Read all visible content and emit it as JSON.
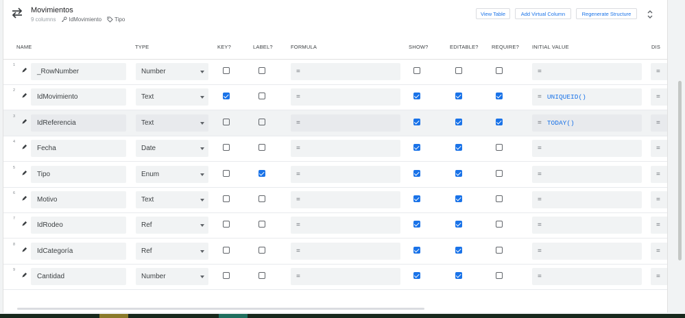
{
  "table": {
    "name": "Movimientos",
    "columns_count": "9 columns",
    "key_column": "IdMovimiento",
    "label_column": "Tipo",
    "swap_icon": "swap-horizontal-icon",
    "key_icon": "key-icon",
    "label_icon": "tag-icon"
  },
  "actions": {
    "view_table": "View Table",
    "add_virtual_column": "Add Virtual Column",
    "regenerate_structure": "Regenerate Structure",
    "expand_icon": "unfold-icon"
  },
  "headers": {
    "name": "NAME",
    "type": "TYPE",
    "key": "KEY?",
    "label": "LABEL?",
    "formula": "FORMULA",
    "show": "SHOW?",
    "editable": "EDITABLE?",
    "require": "REQUIRE?",
    "initial_value": "INITIAL VALUE",
    "display": "DIS"
  },
  "formula_prefix": "=",
  "colors": {
    "accent": "#1a73e8",
    "checkbox_on": "#1a73e8",
    "row_highlight": "#f1f3f4",
    "taskbar": "#17281c"
  },
  "columns": [
    {
      "index": "1",
      "name": "_RowNumber",
      "type": "Number",
      "key": false,
      "label": false,
      "formula": "=",
      "show": false,
      "editable": false,
      "require": false,
      "initial_value": "=",
      "initial_code": "",
      "display": "="
    },
    {
      "index": "2",
      "name": "IdMovimiento",
      "type": "Text",
      "key": true,
      "label": false,
      "formula": "=",
      "show": true,
      "editable": true,
      "require": true,
      "initial_value": "=",
      "initial_code": "UNIQUEID()",
      "display": "="
    },
    {
      "index": "3",
      "name": "IdReferencia",
      "type": "Text",
      "key": false,
      "label": false,
      "formula": "=",
      "show": true,
      "editable": true,
      "require": true,
      "initial_value": "=",
      "initial_code": "TODAY()",
      "display": "="
    },
    {
      "index": "4",
      "name": "Fecha",
      "type": "Date",
      "key": false,
      "label": false,
      "formula": "=",
      "show": true,
      "editable": true,
      "require": false,
      "initial_value": "=",
      "initial_code": "",
      "display": "="
    },
    {
      "index": "5",
      "name": "Tipo",
      "type": "Enum",
      "key": false,
      "label": true,
      "formula": "=",
      "show": true,
      "editable": true,
      "require": false,
      "initial_value": "=",
      "initial_code": "",
      "display": "="
    },
    {
      "index": "6",
      "name": "Motivo",
      "type": "Text",
      "key": false,
      "label": false,
      "formula": "=",
      "show": true,
      "editable": true,
      "require": false,
      "initial_value": "=",
      "initial_code": "",
      "display": "="
    },
    {
      "index": "7",
      "name": "IdRodeo",
      "type": "Ref",
      "key": false,
      "label": false,
      "formula": "=",
      "show": true,
      "editable": true,
      "require": false,
      "initial_value": "=",
      "initial_code": "",
      "display": "="
    },
    {
      "index": "8",
      "name": "IdCategoría",
      "type": "Ref",
      "key": false,
      "label": false,
      "formula": "=",
      "show": true,
      "editable": true,
      "require": false,
      "initial_value": "=",
      "initial_code": "",
      "display": "="
    },
    {
      "index": "9",
      "name": "Cantidad",
      "type": "Number",
      "key": false,
      "label": false,
      "formula": "=",
      "show": true,
      "editable": true,
      "require": false,
      "initial_value": "=",
      "initial_code": "",
      "display": "="
    }
  ],
  "highlighted_row": "3"
}
